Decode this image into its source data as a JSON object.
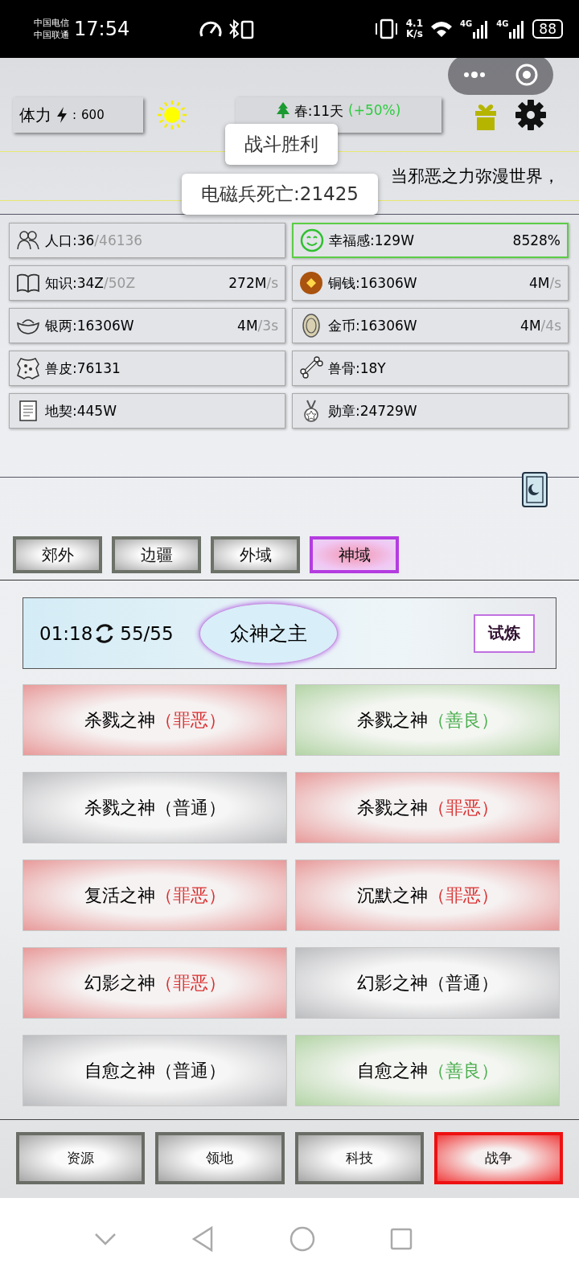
{
  "status_bar": {
    "carriers": [
      "中国电信",
      "中国联通"
    ],
    "time": "17:54",
    "speed_value": "4.1",
    "speed_unit": "K/s",
    "networks": [
      "4G",
      "4G"
    ],
    "battery": "88"
  },
  "top": {
    "stamina_label": "体力",
    "stamina_sep": ":",
    "stamina_value": "600",
    "season": "春:11天",
    "season_bonus": "(+50%)"
  },
  "marquee": "当邪恶之力弥漫世界，",
  "toasts": [
    "战斗胜利",
    "电磁兵死亡:21425"
  ],
  "resources": [
    {
      "kind": "people",
      "label": "人口:36",
      "max": "/46136",
      "highlighted": false
    },
    {
      "kind": "smile",
      "label": "幸福感:129W",
      "rate": "8528%",
      "highlighted": true
    },
    {
      "kind": "book",
      "label": "知识:34Z",
      "max": "/50Z",
      "rate": "272M",
      "rate_unit": "/s",
      "highlighted": false
    },
    {
      "kind": "copper",
      "label": "铜钱:16306W",
      "rate": "4M",
      "rate_unit": "/s",
      "highlighted": false
    },
    {
      "kind": "ingot",
      "label": "银两:16306W",
      "rate": "4M",
      "rate_unit": "/3s",
      "highlighted": false
    },
    {
      "kind": "gold",
      "label": "金币:16306W",
      "rate": "4M",
      "rate_unit": "/4s",
      "highlighted": false
    },
    {
      "kind": "hide",
      "label": "兽皮:76131",
      "highlighted": false
    },
    {
      "kind": "bone",
      "label": "兽骨:18Y",
      "highlighted": false
    },
    {
      "kind": "scroll",
      "label": "地契:445W",
      "highlighted": false
    },
    {
      "kind": "medal",
      "label": "勋章:24729W",
      "highlighted": false
    }
  ],
  "tabs": [
    {
      "label": "郊外",
      "selected": false
    },
    {
      "label": "边疆",
      "selected": false
    },
    {
      "label": "外域",
      "selected": false
    },
    {
      "label": "神域",
      "selected": true
    }
  ],
  "boss": {
    "timer": "01:18",
    "count": "55/55",
    "name": "众神之主",
    "button": "试炼"
  },
  "gods": [
    {
      "name": "杀戮之神",
      "tag": "（罪恶）",
      "kind": "evil"
    },
    {
      "name": "杀戮之神",
      "tag": "（善良）",
      "kind": "good"
    },
    {
      "name": "杀戮之神",
      "tag": "（普通）",
      "kind": "normal"
    },
    {
      "name": "杀戮之神",
      "tag": "（罪恶）",
      "kind": "evil"
    },
    {
      "name": "复活之神",
      "tag": "（罪恶）",
      "kind": "evil"
    },
    {
      "name": "沉默之神",
      "tag": "（罪恶）",
      "kind": "evil"
    },
    {
      "name": "幻影之神",
      "tag": "（罪恶）",
      "kind": "evil"
    },
    {
      "name": "幻影之神",
      "tag": "（普通）",
      "kind": "normal"
    },
    {
      "name": "自愈之神",
      "tag": "（普通）",
      "kind": "normal"
    },
    {
      "name": "自愈之神",
      "tag": "（善良）",
      "kind": "good"
    }
  ],
  "bottom_nav": [
    {
      "label": "资源",
      "selected": false
    },
    {
      "label": "领地",
      "selected": false
    },
    {
      "label": "科技",
      "selected": false
    },
    {
      "label": "战争",
      "selected": true
    }
  ]
}
